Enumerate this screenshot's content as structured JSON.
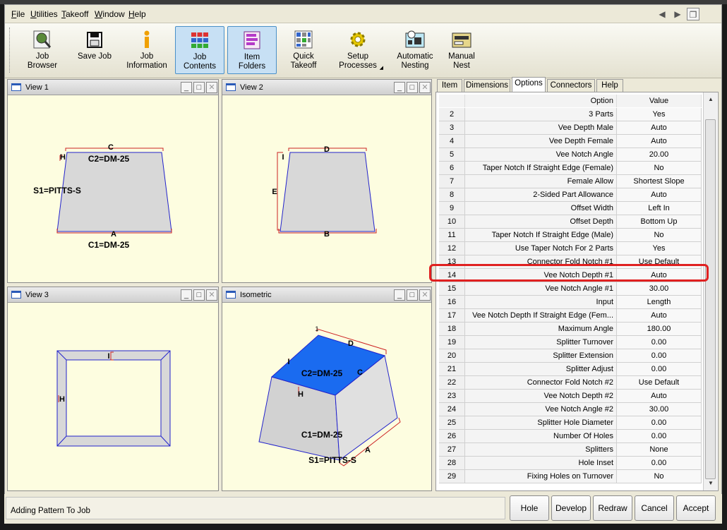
{
  "menu": {
    "items": [
      {
        "u": "F",
        "rest": "ile"
      },
      {
        "u": "U",
        "rest": "tilities"
      },
      {
        "u": "T",
        "rest": "akeoff"
      },
      {
        "u": "W",
        "rest": "indow"
      },
      {
        "u": "H",
        "rest": "elp"
      }
    ]
  },
  "toolbar": {
    "buttons": [
      {
        "line1": "Job",
        "line2": "Browser",
        "icon": "job-browser-icon"
      },
      {
        "line1": "Save Job",
        "line2": "",
        "icon": "save-icon"
      },
      {
        "line1": "Job",
        "line2": "Information",
        "icon": "info-icon"
      },
      {
        "line1": "Job",
        "line2": "Contents",
        "icon": "job-contents-icon"
      },
      {
        "line1": "Item",
        "line2": "Folders",
        "icon": "item-folders-icon"
      },
      {
        "line1": "Quick",
        "line2": "Takeoff",
        "icon": "quick-takeoff-icon"
      },
      {
        "line1": "Setup",
        "line2": "Processes",
        "icon": "gear-icon"
      },
      {
        "line1": "Automatic",
        "line2": "Nesting",
        "icon": "nesting-icon"
      },
      {
        "line1": "Manual",
        "line2": "Nest",
        "icon": "manual-nest-icon"
      }
    ]
  },
  "panes": {
    "view1": {
      "title": "View 1",
      "labels": {
        "c": "C",
        "c2": "C2=DM-25",
        "h": "H",
        "s1": "S1=PITTS-S",
        "a": "A",
        "c1": "C1=DM-25"
      }
    },
    "view2": {
      "title": "View 2",
      "labels": {
        "d": "D",
        "i": "I",
        "e": "E",
        "b": "B"
      }
    },
    "view3": {
      "title": "View 3",
      "labels": {
        "i": "I",
        "h": "H"
      }
    },
    "iso": {
      "title": "Isometric",
      "labels": {
        "d": "D",
        "i": "I",
        "c2": "C2=DM-25",
        "c": "C",
        "h": "H",
        "c1": "C1=DM-25",
        "a": "A",
        "s1": "S1=PITTS-S",
        "one": "1"
      }
    }
  },
  "tabs": [
    "Item",
    "Dimensions",
    "Options",
    "Connectors",
    "Help"
  ],
  "selected_tab": "Options",
  "grid": {
    "headers": {
      "option": "Option",
      "value": "Value"
    },
    "rows": [
      {
        "n": "2",
        "option": "3 Parts",
        "value": "Yes"
      },
      {
        "n": "3",
        "option": "Vee Depth Male",
        "value": "Auto"
      },
      {
        "n": "4",
        "option": "Vee Depth Female",
        "value": "Auto"
      },
      {
        "n": "5",
        "option": "Vee Notch Angle",
        "value": "20.00"
      },
      {
        "n": "6",
        "option": "Taper Notch If Straight Edge (Female)",
        "value": "No"
      },
      {
        "n": "7",
        "option": "Female Allow",
        "value": "Shortest Slope"
      },
      {
        "n": "8",
        "option": "2-Sided Part Allowance",
        "value": "Auto"
      },
      {
        "n": "9",
        "option": "Offset Width",
        "value": "Left In"
      },
      {
        "n": "10",
        "option": "Offset Depth",
        "value": "Bottom Up"
      },
      {
        "n": "11",
        "option": "Taper Notch If Straight Edge (Male)",
        "value": "No"
      },
      {
        "n": "12",
        "option": "Use Taper Notch For 2 Parts",
        "value": "Yes"
      },
      {
        "n": "13",
        "option": "Connector Fold Notch #1",
        "value": "Use Default"
      },
      {
        "n": "14",
        "option": "Vee Notch Depth #1",
        "value": "Auto"
      },
      {
        "n": "15",
        "option": "Vee Notch Angle #1",
        "value": "30.00"
      },
      {
        "n": "16",
        "option": "Input",
        "value": "Length"
      },
      {
        "n": "17",
        "option": "Vee Notch Depth If Straight Edge (Fem...",
        "value": "Auto"
      },
      {
        "n": "18",
        "option": "Maximum Angle",
        "value": "180.00"
      },
      {
        "n": "19",
        "option": "Splitter Turnover",
        "value": "0.00"
      },
      {
        "n": "20",
        "option": "Splitter Extension",
        "value": "0.00"
      },
      {
        "n": "21",
        "option": "Splitter Adjust",
        "value": "0.00"
      },
      {
        "n": "22",
        "option": "Connector Fold Notch #2",
        "value": "Use Default"
      },
      {
        "n": "23",
        "option": "Vee Notch Depth #2",
        "value": "Auto"
      },
      {
        "n": "24",
        "option": "Vee Notch Angle #2",
        "value": "30.00"
      },
      {
        "n": "25",
        "option": "Splitter Hole Diameter",
        "value": "0.00"
      },
      {
        "n": "26",
        "option": "Number Of Holes",
        "value": "0.00"
      },
      {
        "n": "27",
        "option": "Splitters",
        "value": "None"
      },
      {
        "n": "28",
        "option": "Hole Inset",
        "value": "0.00"
      },
      {
        "n": "29",
        "option": "Fixing Holes on Turnover",
        "value": "No"
      }
    ]
  },
  "status": {
    "text": "Adding Pattern To Job"
  },
  "buttons": [
    "Hole",
    "Develop",
    "Redraw",
    "Cancel",
    "Accept"
  ],
  "colors": {
    "highlight": "#e02020",
    "top_face": "#1a6bf0",
    "outline": "#2222cc",
    "dim": "#cc2222"
  }
}
